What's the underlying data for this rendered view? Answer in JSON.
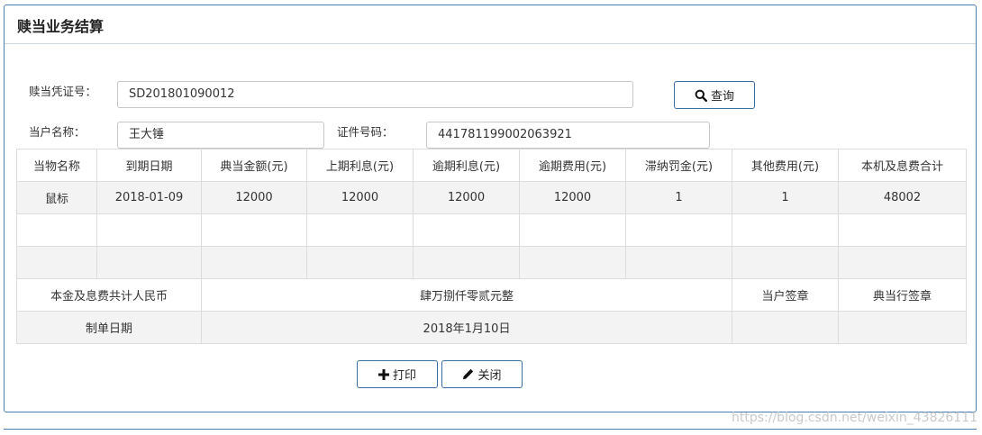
{
  "panel": {
    "title": "赎当业务结算"
  },
  "form": {
    "voucher_label": "赎当凭证号：",
    "voucher_value": "SD201801090012",
    "query_label": "查询",
    "customer_label": "当户名称：",
    "customer_value": "王大锤",
    "id_label": "证件号码：",
    "id_value": "441781199002063921"
  },
  "table": {
    "headers": [
      "当物名称",
      "到期日期",
      "典当金额(元)",
      "上期利息(元)",
      "逾期利息(元)",
      "逾期费用(元)",
      "滞纳罚金(元)",
      "其他费用(元)",
      "本机及息费合计"
    ],
    "row1": [
      "鼠标",
      "2018-01-09",
      "12000",
      "12000",
      "12000",
      "12000",
      "1",
      "1",
      "48002"
    ],
    "total_label": "本金及息费共计人民币",
    "total_value": "肆万捌仟零贰元整",
    "customer_sign": "当户签章",
    "shop_sign": "典当行签章",
    "date_label": "制单日期",
    "date_value": "2018年1月10日"
  },
  "actions": {
    "print_label": "打印",
    "close_label": "关闭"
  },
  "watermark": "https://blog.csdn.net/weixin_43826111",
  "colors": {
    "border_blue": "#4a7db5",
    "row_shade": "#f3f3f3"
  }
}
